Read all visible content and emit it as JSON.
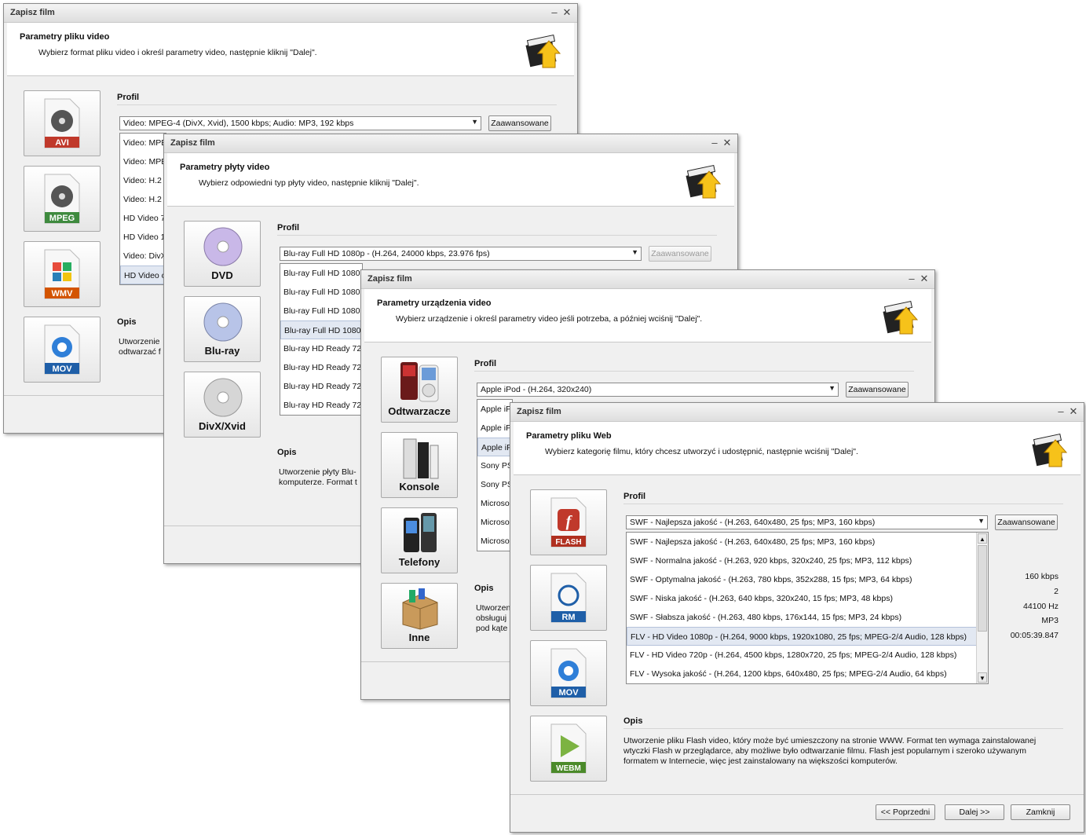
{
  "windows": {
    "w1": {
      "title": "Zapisz film",
      "header_title": "Parametry pliku video",
      "header_sub": "Wybierz format pliku video i określ parametry video, następnie kliknij \"Dalej\".",
      "formats": [
        "AVI",
        "MPEG",
        "WMV",
        "MOV"
      ],
      "profile_label": "Profil",
      "profile_value": "Video: MPEG-4 (DivX, Xvid), 1500 kbps; Audio: MP3, 192 kbps",
      "advanced": "Zaawansowane",
      "list": [
        "Video: MPE",
        "Video: MPE",
        "Video: H.2",
        "Video: H.2",
        "HD Video 7",
        "HD Video 1",
        "Video: DivX",
        "HD Video c"
      ],
      "opis_label": "Opis",
      "desc": "Utworzenie\nodtwarzać f"
    },
    "w2": {
      "title": "Zapisz film",
      "header_title": "Parametry płyty video",
      "header_sub": "Wybierz odpowiedni typ płyty video, następnie kliknij \"Dalej\".",
      "formats": [
        "DVD",
        "Blu-ray",
        "DivX/Xvid"
      ],
      "profile_label": "Profil",
      "profile_value": "Blu-ray Full HD 1080p - (H.264, 24000 kbps, 23.976 fps)",
      "advanced": "Zaawansowane",
      "list": [
        "Blu-ray Full HD 1080",
        "Blu-ray Full HD 1080",
        "Blu-ray Full HD 1080",
        "Blu-ray Full HD 1080",
        "Blu-ray HD Ready 72",
        "Blu-ray HD Ready 72",
        "Blu-ray HD Ready 72",
        "Blu-ray HD Ready 72"
      ],
      "opis_label": "Opis",
      "desc": "Utworzenie płyty Blu-\nkomputerze. Format t"
    },
    "w3": {
      "title": "Zapisz film",
      "header_title": "Parametry urządzenia video",
      "header_sub": "Wybierz urządzenie i określ parametry video jeśli potrzeba, a później wciśnij \"Dalej\".",
      "formats": [
        "Odtwarzacze",
        "Konsole",
        "Telefony",
        "Inne"
      ],
      "profile_label": "Profil",
      "profile_value": "Apple iPod - (H.264, 320x240)",
      "advanced": "Zaawansowane",
      "list": [
        "Apple iP",
        "Apple iP",
        "Apple iP",
        "Sony PS",
        "Sony PS",
        "Microso",
        "Microso",
        "Microso"
      ],
      "opis_label": "Opis",
      "desc": "Utworzen\nobsługuj\npod kąte"
    },
    "w4": {
      "title": "Zapisz film",
      "header_title": "Parametry pliku Web",
      "header_sub": "Wybierz kategorię filmu, który chcesz utworzyć i udostępnić, następnie wciśnij \"Dalej\".",
      "formats": [
        "FLASH",
        "RM",
        "MOV",
        "WEBM"
      ],
      "profile_label": "Profil",
      "profile_value": "SWF - Najlepsza jakość - (H.263, 640x480, 25 fps; MP3, 160 kbps)",
      "advanced": "Zaawansowane",
      "list": [
        "SWF - Najlepsza jakość - (H.263, 640x480, 25 fps; MP3, 160 kbps)",
        "SWF - Normalna jakość - (H.263, 920 kbps, 320x240, 25 fps; MP3, 112 kbps)",
        "SWF - Optymalna jakość - (H.263, 780 kbps, 352x288, 15 fps; MP3, 64 kbps)",
        "SWF - Niska jakość - (H.263, 640 kbps, 320x240, 15 fps; MP3, 48 kbps)",
        "SWF - Słabsza jakość - (H.263, 480 kbps, 176x144, 15 fps; MP3, 24 kbps)",
        "FLV - HD Video 1080p - (H.264, 9000 kbps, 1920x1080, 25 fps; MPEG-2/4 Audio, 128 kbps)",
        "FLV - HD Video 720p - (H.264, 4500 kbps, 1280x720, 25 fps; MPEG-2/4 Audio, 128 kbps)",
        "FLV - Wysoka jakość - (H.264, 1200 kbps, 640x480, 25 fps; MPEG-2/4 Audio, 64 kbps)"
      ],
      "values": [
        "160 kbps",
        "2",
        "44100 Hz",
        "MP3",
        "00:05:39.847"
      ],
      "opis_label": "Opis",
      "desc": "Utworzenie pliku Flash video, który może być umieszczony na stronie WWW. Format ten wymaga zainstalowanej wtyczki Flash w przeglądarce, aby możliwe było odtwarzanie filmu. Flash jest popularnym i szeroko używanym formatem w Internecie, więc jest zainstalowany na większości komputerów.",
      "btn_prev": "<< Poprzedni",
      "btn_next": "Dalej >>",
      "btn_close": "Zamknij"
    }
  }
}
